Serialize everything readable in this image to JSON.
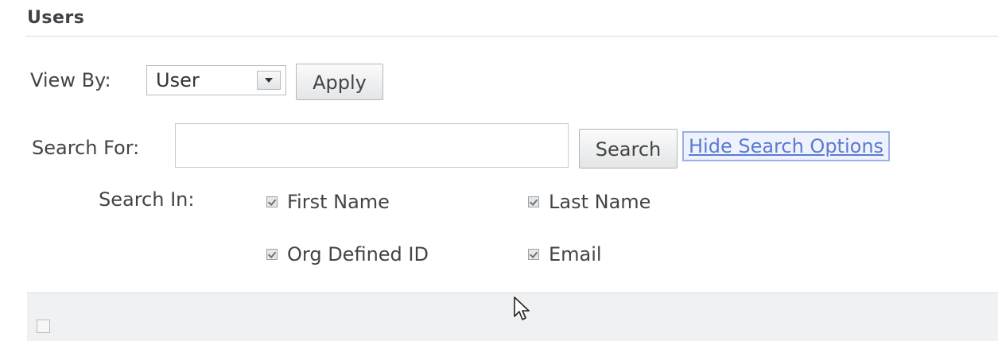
{
  "section": {
    "title": "Users"
  },
  "view_by": {
    "label": "View By:",
    "selected": "User",
    "arrow_icon": "chevron-down-icon",
    "apply_label": "Apply"
  },
  "search": {
    "label": "Search For:",
    "value": "",
    "placeholder": "",
    "button_label": "Search",
    "hide_options_label": "Hide Search Options"
  },
  "search_in": {
    "label": "Search In:",
    "options": [
      {
        "label": "First Name",
        "checked": true
      },
      {
        "label": "Last Name",
        "checked": true
      },
      {
        "label": "Org Defined ID",
        "checked": true
      },
      {
        "label": "Email",
        "checked": true
      }
    ]
  },
  "grid": {
    "select_all_checked": false
  },
  "colors": {
    "link": "#5c7ad2",
    "link_highlight_border": "#9ab0e6",
    "grid_header_bg": "#f0f1f2"
  }
}
